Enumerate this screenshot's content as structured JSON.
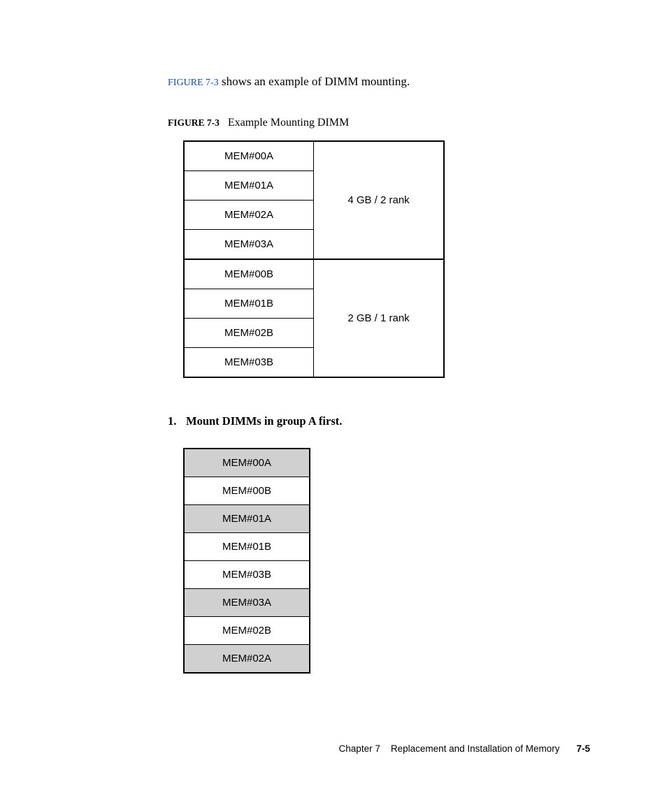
{
  "intro": {
    "fig_ref": "FIGURE 7-3",
    "rest": " shows an example of DIMM mounting."
  },
  "figure": {
    "num": "FIGURE 7-3",
    "title": "Example Mounting DIMM",
    "groups": [
      {
        "slots": [
          "MEM#00A",
          "MEM#01A",
          "MEM#02A",
          "MEM#03A"
        ],
        "spec": "4 GB / 2 rank"
      },
      {
        "slots": [
          "MEM#00B",
          "MEM#01B",
          "MEM#02B",
          "MEM#03B"
        ],
        "spec": "2 GB / 1 rank"
      }
    ]
  },
  "step": {
    "num": "1.",
    "text": "Mount DIMMs in group A first."
  },
  "mount": [
    {
      "label": "MEM#00A",
      "shaded": true
    },
    {
      "label": "MEM#00B",
      "shaded": false
    },
    {
      "label": "MEM#01A",
      "shaded": true
    },
    {
      "label": "MEM#01B",
      "shaded": false
    },
    {
      "label": "MEM#03B",
      "shaded": false
    },
    {
      "label": "MEM#03A",
      "shaded": true
    },
    {
      "label": "MEM#02B",
      "shaded": false
    },
    {
      "label": "MEM#02A",
      "shaded": true
    }
  ],
  "footer": {
    "chapter": "Chapter 7",
    "title": "Replacement and Installation of Memory",
    "page": "7-5"
  }
}
